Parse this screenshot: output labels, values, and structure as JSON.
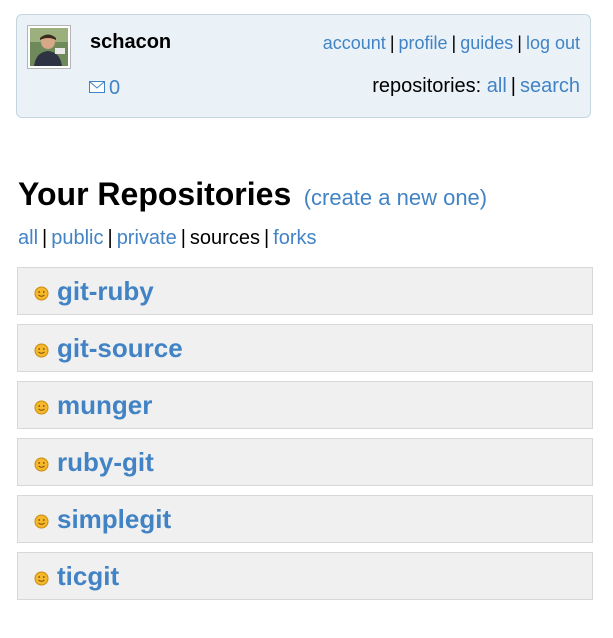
{
  "user": {
    "username": "schacon",
    "inbox_count": "0"
  },
  "top_nav": {
    "account": "account",
    "profile": "profile",
    "guides": "guides",
    "logout": "log out"
  },
  "repositories_nav": {
    "label": "repositories:",
    "all": "all",
    "search": "search"
  },
  "main": {
    "title": "Your Repositories",
    "create_link": "(create a new one)"
  },
  "filters": {
    "all": "all",
    "public": "public",
    "private": "private",
    "sources": "sources",
    "forks": "forks"
  },
  "repos": [
    {
      "name": "git-ruby"
    },
    {
      "name": "git-source"
    },
    {
      "name": "munger"
    },
    {
      "name": "ruby-git"
    },
    {
      "name": "simplegit"
    },
    {
      "name": "ticgit"
    }
  ],
  "colors": {
    "link": "#4183c4",
    "panel_bg": "#eaf2f8",
    "repo_bg": "#f0f0f0",
    "repo_icon": "#f0a020"
  }
}
